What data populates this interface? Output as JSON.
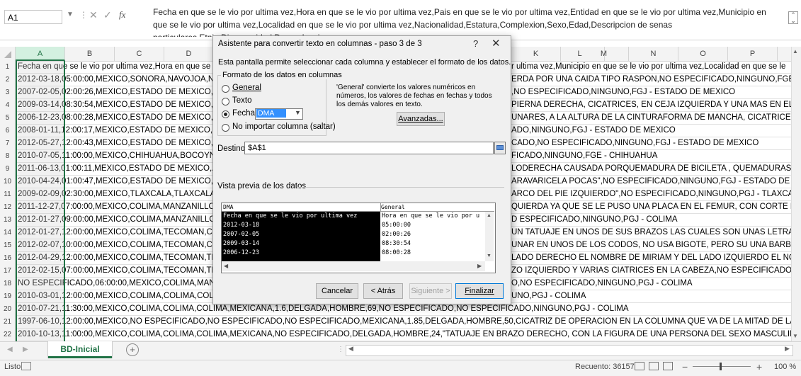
{
  "formula_bar": {
    "name_box": "A1",
    "fx": "fx",
    "text": "Fecha en que se le vio por ultima vez,Hora en que se le vio por ultima vez,Pais en que se le vio por ultima vez,Entidad en que se le vio por ultima vez,Municipio en que se le vio por ultima vez,Localidad en que se le vio por ultima vez,Nacionalidad,Estatura,Complexion,Sexo,Edad,Descripcion de senas particulares,Etnia,Discapacidad,Dependencia"
  },
  "grid": {
    "columns": [
      "A",
      "B",
      "C",
      "D",
      "E",
      "F",
      "G",
      "H",
      "I",
      "J",
      "K",
      "L",
      "M",
      "N",
      "O",
      "P"
    ],
    "selected_column": "A",
    "rows": [
      {
        "n": "1",
        "left": "Fecha en que se le vio por ultima vez,Hora en que se le",
        "right": "r ultima vez,Municipio en que se le vio por ultima vez,Localidad en que se le"
      },
      {
        "n": "2",
        "left": "2012-03-18,05:00:00,MEXICO,SONORA,NAVOJOA,NAV",
        "right": "ERDA POR UNA CAIDA TIPO RASPON,NO ESPECIFICADO,NINGUNO,FGE - SONO"
      },
      {
        "n": "3",
        "left": "2007-02-05,02:00:26,MEXICO,ESTADO DE MEXICO,VALL",
        "right": ",NO ESPECIFICADO,NINGUNO,FGJ - ESTADO DE MEXICO"
      },
      {
        "n": "4",
        "left": "2009-03-14,08:30:54,MEXICO,ESTADO DE MEXICO,CHAL",
        "right": "PIERNA DERECHA, CICATRICES, EN CEJA IZQUIERDA Y UNA MAS EN EL LADO IZQ"
      },
      {
        "n": "5",
        "left": "2006-12-23,08:00:28,MEXICO,ESTADO DE MEXICO,TLAL",
        "right": "UNARES, A LA ALTURA DE LA CINTURAFORMA DE MANCHA, CICATRICES, A UN L"
      },
      {
        "n": "6",
        "left": "2008-01-11,12:00:17,MEXICO,ESTADO DE MEXICO,TOLU",
        "right": "ADO,NINGUNO,FGJ - ESTADO DE MEXICO"
      },
      {
        "n": "7",
        "left": "2012-05-27,12:00:43,MEXICO,ESTADO DE MEXICO,NICO",
        "right": "CADO,NO ESPECIFICADO,NINGUNO,FGJ - ESTADO DE MEXICO"
      },
      {
        "n": "8",
        "left": "2010-07-05,11:00:00,MEXICO,CHIHUAHUA,BOCOYNA,C",
        "right": "FICADO,NINGUNO,FGE - CHIHUAHUA"
      },
      {
        "n": "9",
        "left": "2011-06-13,01:00:11,MEXICO,ESTADO DE MEXICO,AME",
        "right": "LODERECHA CAUSADA PORQUEMADURA DE BICILETA , QUEMADURAS, , CICATI"
      },
      {
        "n": "10",
        "left": "2010-04-24,01:00:47,MEXICO,ESTADO DE MEXICO,TEOL",
        "right": "ARAVARICELA POCAS\",NO ESPECIFICADO,NINGUNO,FGJ - ESTADO DE MEXICO"
      },
      {
        "n": "11",
        "left": "2009-02-09,02:30:00,MEXICO,TLAXCALA,TLAXCALA,TLA",
        "right": "ARCO DEL PIE IZQUIERDO\",NO ESPECIFICADO,NINGUNO,PGJ - TLAXCALA"
      },
      {
        "n": "12",
        "left": "2011-12-27,07:00:00,MEXICO,COLIMA,MANZANILLO,DE",
        "right": "QUIERDA YA QUE SE LE PUSO UNA PLACA EN EL FEMUR, CON CORTE DE VOLCAN"
      },
      {
        "n": "13",
        "left": "2012-01-27,09:00:00,MEXICO,COLIMA,MANZANILLO,EL",
        "right": "D ESPECIFICADO,NINGUNO,PGJ - COLIMA"
      },
      {
        "n": "14",
        "left": "2012-01-27,12:00:00,MEXICO,COLIMA,TECOMAN,CERR",
        "right": "UN TATUAJE EN UNOS DE SUS BRAZOS LAS CUALES SON UNAS LETRAS QUE DIC"
      },
      {
        "n": "15",
        "left": "2012-02-07,10:00:00,MEXICO,COLIMA,TECOMAN,CERR",
        "right": "UNAR EN UNOS DE LOS CODOS,  NO USA BIGOTE, PERO SU UNA BARBA,\",NO ES"
      },
      {
        "n": "16",
        "left": "2012-04-29,12:00:00,MEXICO,COLIMA,TECOMAN,TECO",
        "right": "LADO DERECHO EL NOMBRE DE MIRIAM Y DEL LADO IZQUIERDO EL NOMBRE DE"
      },
      {
        "n": "17",
        "left": "2012-02-15,07:00:00,MEXICO,COLIMA,TECOMAN,TECO",
        "right": "ZO IZQUIERDO Y VARIAS CIATRICES EN LA CABEZA,NO ESPECIFICADO,NINGUN"
      },
      {
        "n": "18",
        "left": "NO ESPECIFICADO,06:00:00,MEXICO,COLIMA,MANZAN",
        "right": "O,NO ESPECIFICADO,NINGUNO,PGJ - COLIMA"
      },
      {
        "n": "19",
        "left": "2010-03-01,12:00:00,MEXICO,COLIMA,COLIMA,COLIMA",
        "right": "UNO,PGJ - COLIMA"
      },
      {
        "n": "20",
        "left": "2010-07-21,11:30:00,MEXICO,COLIMA,COLIMA,COLIMA,MEXICANA,1.6,DELGADA,HOMBRE,69,NO ESPECIFICADO,NO ESPECIFICADO,NINGUNO,PGJ - COLIMA",
        "right": ""
      },
      {
        "n": "21",
        "left": "1997-06-10,12:00:00,MEXICO,NO ESPECIFICADO,NO ESPECIFICADO,NO ESPECIFICADO,MEXICANA,1.85,DELGADA,HOMBRE,50,CICATRIZ DE OPERACION EN LA COLUMNA QUE VA DE LA MITAD DE LA ESPALDA A LA NUCA",
        "right": ""
      },
      {
        "n": "22",
        "left": "2010-10-13,11:00:00,MEXICO,COLIMA,COLIMA,COLIMA,MEXICANA,NO ESPECIFICADO,DELGADA,HOMBRE,24,\"TATUAJE EN BRAZO DERECHO, CON LA FIGURA DE UNA PERSONA DEL SEXO MASCULINO DE EMILIANO ZAP",
        "right": ""
      }
    ]
  },
  "sheet": {
    "tab": "BD-Inicial",
    "add_label": "+"
  },
  "status": {
    "ready": "Listo",
    "count": "Recuento: 36157",
    "zoom": "100 %"
  },
  "dialog": {
    "title": "Asistente para convertir texto en columnas - paso 3 de 3",
    "help": "?",
    "close": "✕",
    "description": "Esta pantalla permite seleccionar cada columna y establecer el formato de los datos.",
    "format_group": "Formato de los datos en columnas",
    "radio_general": "General",
    "radio_text": "Texto",
    "radio_date": "Fecha:",
    "radio_skip": "No importar columna (saltar)",
    "date_format": "DMA",
    "general_help": "'General' convierte los valores numéricos en números, los valores de fechas en fechas y todos los demás valores en texto.",
    "advanced": "Avanzadas...",
    "destination_label": "Destino:",
    "destination_value": "$A$1",
    "preview_label": "Vista previa de los datos",
    "preview_headers": [
      "DMA",
      "General"
    ],
    "preview_col1": [
      "Fecha en que se le vio por ultima vez",
      "2012-03-18",
      "2007-02-05",
      "2009-03-14",
      "2006-12-23"
    ],
    "preview_col2": [
      "Hora en que se le vio por u",
      "05:00:00",
      "02:00:26",
      "08:30:54",
      "08:00:28"
    ],
    "cancel": "Cancelar",
    "back": "< Atrás",
    "next": "Siguiente >",
    "finish": "Finalizar"
  }
}
